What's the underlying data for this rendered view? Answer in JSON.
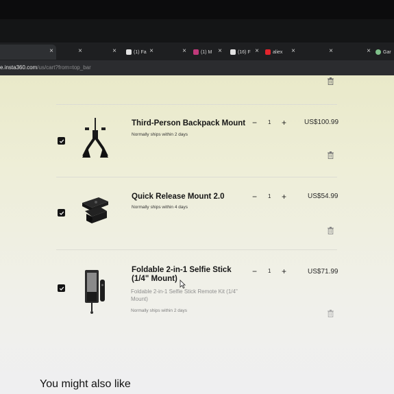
{
  "browser": {
    "tabs": [
      {
        "label": "",
        "active": true
      },
      {
        "label": "",
        "active": false
      },
      {
        "label": "",
        "active": false
      },
      {
        "label": "(1) Fa",
        "active": false
      },
      {
        "label": "(1) M",
        "active": false
      },
      {
        "label": "(16) F",
        "active": false
      },
      {
        "label": "aliex",
        "active": false
      },
      {
        "label": "",
        "active": false
      },
      {
        "label": "Gar",
        "active": false
      }
    ],
    "url": {
      "host": "e.insta360.com",
      "path": "/us/cart?from=top_bar"
    }
  },
  "cart": {
    "items": [
      {
        "name_line1": "Third-Person Backpack Mount",
        "name_line2": "",
        "subtitle": "",
        "shipping": "Normally ships within 2 days",
        "quantity": "1",
        "price": "US$100.99",
        "checked": true
      },
      {
        "name_line1": "Quick Release Mount 2.0",
        "name_line2": "",
        "subtitle": "",
        "shipping": "Normally ships within 4 days",
        "quantity": "1",
        "price": "US$54.99",
        "checked": true
      },
      {
        "name_line1": "Foldable 2-in-1 Selfie Stick",
        "name_line2": "(1/4\" Mount)",
        "subtitle_line1": "Foldable 2-in-1 Selfie Stick Remote Kit (1/4\"",
        "subtitle_line2": "Mount)",
        "shipping": "Normally ships within 2 days",
        "quantity": "1",
        "price": "US$71.99",
        "checked": true
      }
    ],
    "controls": {
      "minus": "−",
      "plus": "+"
    }
  },
  "recommendations": {
    "title": "You might also like"
  },
  "colors": {
    "checkbox": "#141414",
    "tab_bar": "#1e1f21",
    "address_bar": "#2b2c2f"
  }
}
